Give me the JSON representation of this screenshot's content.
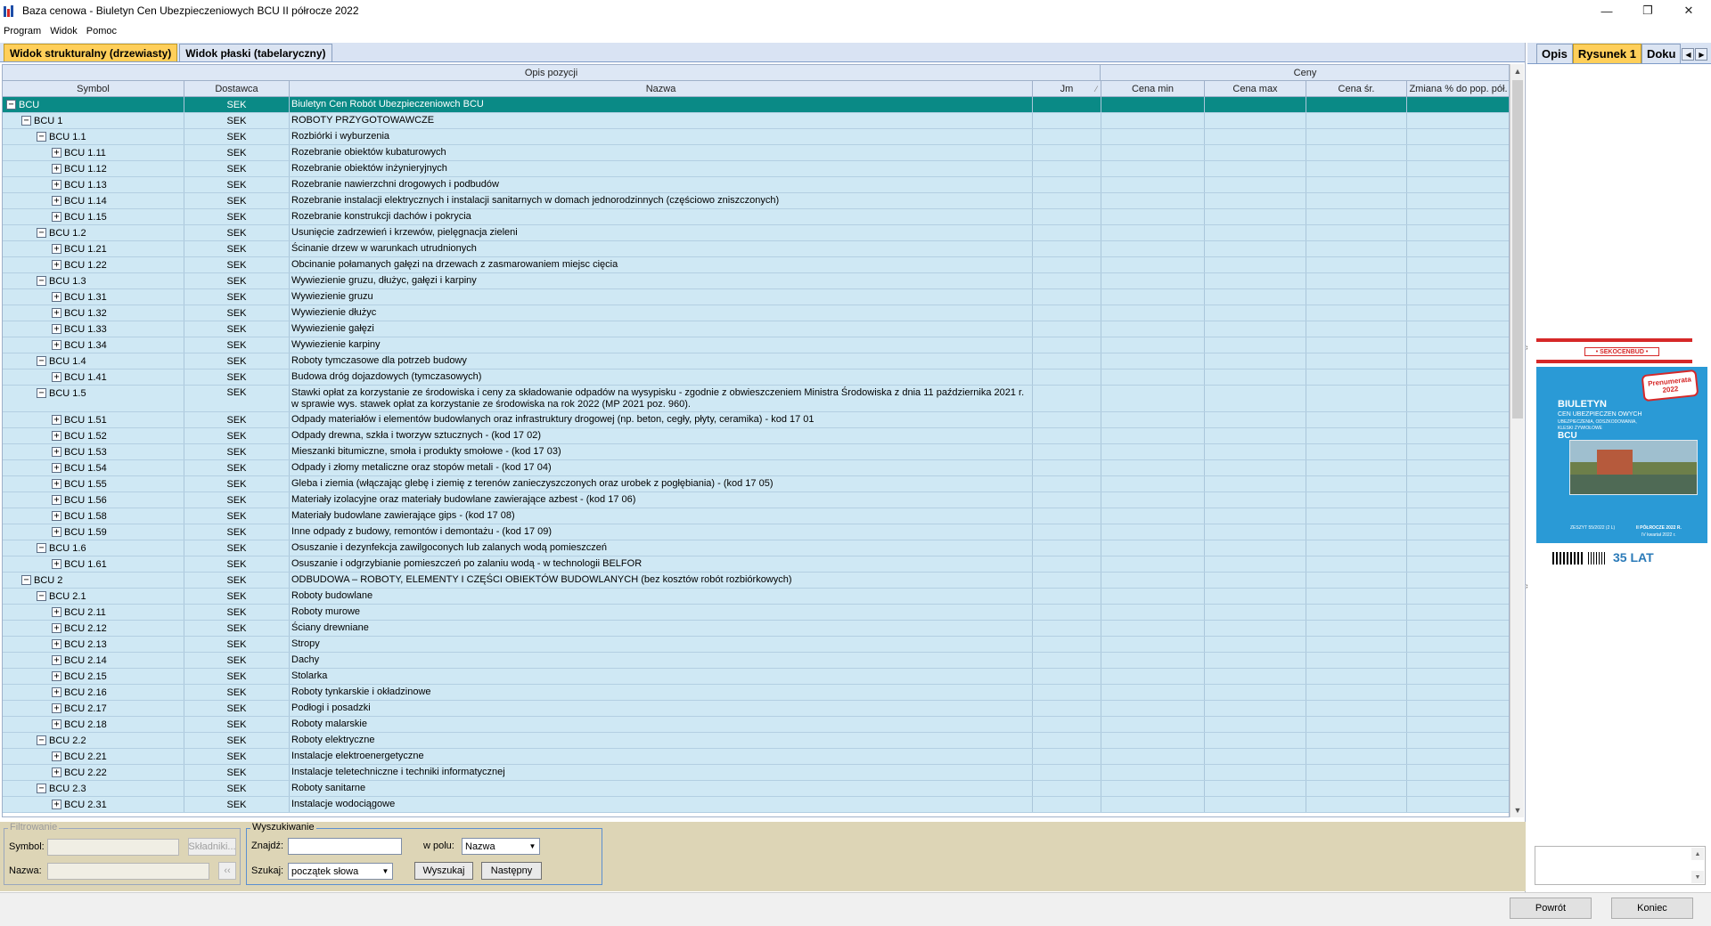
{
  "window": {
    "title": "Baza cenowa - Biuletyn Cen Ubezpieczeniowych BCU II półrocze 2022"
  },
  "menu": [
    "Program",
    "Widok",
    "Pomoc"
  ],
  "tabs": [
    "Widok strukturalny (drzewiasty)",
    "Widok płaski (tabelaryczny)"
  ],
  "header_groups": {
    "opis": "Opis pozycji",
    "ceny": "Ceny"
  },
  "columns": {
    "symbol": "Symbol",
    "dostawca": "Dostawca",
    "nazwa": "Nazwa",
    "jm": "Jm",
    "cena_min": "Cena min",
    "cena_max": "Cena max",
    "cena_sr": "Cena śr.",
    "zmiana": "Zmiana % do pop. pół."
  },
  "rows": [
    {
      "level": 0,
      "sign": "−",
      "symbol": "BCU",
      "dostawca": "SEK",
      "nazwa": "Biuletyn Cen Robót Ubezpieczeniowch BCU",
      "selected": true
    },
    {
      "level": 1,
      "sign": "−",
      "symbol": "BCU 1",
      "dostawca": "SEK",
      "nazwa": "ROBOTY PRZYGOTOWAWCZE"
    },
    {
      "level": 2,
      "sign": "−",
      "symbol": "BCU 1.1",
      "dostawca": "SEK",
      "nazwa": "Rozbiórki i wyburzenia"
    },
    {
      "level": 3,
      "sign": "+",
      "symbol": "BCU 1.11",
      "dostawca": "SEK",
      "nazwa": "Rozebranie obiektów kubaturowych"
    },
    {
      "level": 3,
      "sign": "+",
      "symbol": "BCU 1.12",
      "dostawca": "SEK",
      "nazwa": "Rozebranie obiektów inżynieryjnych"
    },
    {
      "level": 3,
      "sign": "+",
      "symbol": "BCU 1.13",
      "dostawca": "SEK",
      "nazwa": "Rozebranie nawierzchni drogowych i podbudów"
    },
    {
      "level": 3,
      "sign": "+",
      "symbol": "BCU 1.14",
      "dostawca": "SEK",
      "nazwa": "Rozebranie instalacji elektrycznych i instalacji sanitarnych w domach jednorodzinnych (częściowo zniszczonych)"
    },
    {
      "level": 3,
      "sign": "+",
      "symbol": "BCU 1.15",
      "dostawca": "SEK",
      "nazwa": "Rozebranie konstrukcji dachów i pokrycia"
    },
    {
      "level": 2,
      "sign": "−",
      "symbol": "BCU 1.2",
      "dostawca": "SEK",
      "nazwa": "Usunięcie zadrzewień i krzewów, pielęgnacja zieleni"
    },
    {
      "level": 3,
      "sign": "+",
      "symbol": "BCU 1.21",
      "dostawca": "SEK",
      "nazwa": "Ścinanie drzew w warunkach utrudnionych"
    },
    {
      "level": 3,
      "sign": "+",
      "symbol": "BCU 1.22",
      "dostawca": "SEK",
      "nazwa": "Obcinanie połamanych gałęzi na drzewach z zasmarowaniem miejsc cięcia"
    },
    {
      "level": 2,
      "sign": "−",
      "symbol": "BCU 1.3",
      "dostawca": "SEK",
      "nazwa": "Wywiezienie gruzu, dłużyc, gałęzi i karpiny"
    },
    {
      "level": 3,
      "sign": "+",
      "symbol": "BCU 1.31",
      "dostawca": "SEK",
      "nazwa": "Wywiezienie gruzu"
    },
    {
      "level": 3,
      "sign": "+",
      "symbol": "BCU 1.32",
      "dostawca": "SEK",
      "nazwa": "Wywiezienie dłużyc"
    },
    {
      "level": 3,
      "sign": "+",
      "symbol": "BCU 1.33",
      "dostawca": "SEK",
      "nazwa": "Wywiezienie gałęzi"
    },
    {
      "level": 3,
      "sign": "+",
      "symbol": "BCU 1.34",
      "dostawca": "SEK",
      "nazwa": "Wywiezienie karpiny"
    },
    {
      "level": 2,
      "sign": "−",
      "symbol": "BCU 1.4",
      "dostawca": "SEK",
      "nazwa": "Roboty tymczasowe dla potrzeb budowy"
    },
    {
      "level": 3,
      "sign": "+",
      "symbol": "BCU 1.41",
      "dostawca": "SEK",
      "nazwa": "Budowa dróg dojazdowych (tymczasowych)"
    },
    {
      "level": 2,
      "sign": "−",
      "symbol": "BCU 1.5",
      "dostawca": "SEK",
      "nazwa": "Stawki opłat za korzystanie ze środowiska i ceny za składowanie odpadów na wysypisku - zgodnie z obwieszczeniem Ministra Środowiska z dnia 11 października 2021 r. w sprawie wys. stawek opłat za korzystanie ze środowiska na rok 2022 (MP 2021 poz. 960).",
      "tall": true
    },
    {
      "level": 3,
      "sign": "+",
      "symbol": "BCU 1.51",
      "dostawca": "SEK",
      "nazwa": "Odpady materiałów i elementów budowlanych oraz infrastruktury drogowej (np. beton, cegły, płyty, ceramika) - kod 17 01"
    },
    {
      "level": 3,
      "sign": "+",
      "symbol": "BCU 1.52",
      "dostawca": "SEK",
      "nazwa": "Odpady drewna, szkła i tworzyw sztucznych - (kod 17 02)"
    },
    {
      "level": 3,
      "sign": "+",
      "symbol": "BCU 1.53",
      "dostawca": "SEK",
      "nazwa": "Mieszanki bitumiczne, smoła i produkty smołowe - (kod 17 03)"
    },
    {
      "level": 3,
      "sign": "+",
      "symbol": "BCU 1.54",
      "dostawca": "SEK",
      "nazwa": "Odpady i złomy metaliczne oraz stopów metali - (kod 17 04)"
    },
    {
      "level": 3,
      "sign": "+",
      "symbol": "BCU 1.55",
      "dostawca": "SEK",
      "nazwa": "Gleba i ziemia (włączając glebę i ziemię z terenów zanieczyszczonych oraz urobek z pogłębiania) - (kod 17 05)"
    },
    {
      "level": 3,
      "sign": "+",
      "symbol": "BCU 1.56",
      "dostawca": "SEK",
      "nazwa": "Materiały izolacyjne oraz materiały budowlane zawierające azbest - (kod 17 06)"
    },
    {
      "level": 3,
      "sign": "+",
      "symbol": "BCU 1.58",
      "dostawca": "SEK",
      "nazwa": "Materiały budowlane zawierające gips - (kod 17 08)"
    },
    {
      "level": 3,
      "sign": "+",
      "symbol": "BCU 1.59",
      "dostawca": "SEK",
      "nazwa": "Inne odpady z budowy, remontów i demontażu - (kod 17 09)"
    },
    {
      "level": 2,
      "sign": "−",
      "symbol": "BCU 1.6",
      "dostawca": "SEK",
      "nazwa": "Osuszanie i dezynfekcja zawilgoconych lub zalanych wodą pomieszczeń"
    },
    {
      "level": 3,
      "sign": "+",
      "symbol": "BCU 1.61",
      "dostawca": "SEK",
      "nazwa": "Osuszanie i odgrzybianie pomieszczeń po zalaniu wodą - w technologii BELFOR"
    },
    {
      "level": 1,
      "sign": "−",
      "symbol": "BCU 2",
      "dostawca": "SEK",
      "nazwa": "ODBUDOWA – ROBOTY, ELEMENTY I CZĘŚCI OBIEKTÓW BUDOWLANYCH (bez kosztów robót rozbiórkowych)"
    },
    {
      "level": 2,
      "sign": "−",
      "symbol": "BCU 2.1",
      "dostawca": "SEK",
      "nazwa": "Roboty budowlane"
    },
    {
      "level": 3,
      "sign": "+",
      "symbol": "BCU 2.11",
      "dostawca": "SEK",
      "nazwa": "Roboty murowe"
    },
    {
      "level": 3,
      "sign": "+",
      "symbol": "BCU 2.12",
      "dostawca": "SEK",
      "nazwa": "Ściany drewniane"
    },
    {
      "level": 3,
      "sign": "+",
      "symbol": "BCU 2.13",
      "dostawca": "SEK",
      "nazwa": "Stropy"
    },
    {
      "level": 3,
      "sign": "+",
      "symbol": "BCU 2.14",
      "dostawca": "SEK",
      "nazwa": "Dachy"
    },
    {
      "level": 3,
      "sign": "+",
      "symbol": "BCU 2.15",
      "dostawca": "SEK",
      "nazwa": "Stolarka"
    },
    {
      "level": 3,
      "sign": "+",
      "symbol": "BCU 2.16",
      "dostawca": "SEK",
      "nazwa": "Roboty tynkarskie i okładzinowe"
    },
    {
      "level": 3,
      "sign": "+",
      "symbol": "BCU 2.17",
      "dostawca": "SEK",
      "nazwa": "Podłogi i posadzki"
    },
    {
      "level": 3,
      "sign": "+",
      "symbol": "BCU 2.18",
      "dostawca": "SEK",
      "nazwa": "Roboty malarskie"
    },
    {
      "level": 2,
      "sign": "−",
      "symbol": "BCU 2.2",
      "dostawca": "SEK",
      "nazwa": "Roboty elektryczne"
    },
    {
      "level": 3,
      "sign": "+",
      "symbol": "BCU 2.21",
      "dostawca": "SEK",
      "nazwa": "Instalacje elektroenergetyczne"
    },
    {
      "level": 3,
      "sign": "+",
      "symbol": "BCU 2.22",
      "dostawca": "SEK",
      "nazwa": "Instalacje teletechniczne i techniki informatycznej"
    },
    {
      "level": 2,
      "sign": "−",
      "symbol": "BCU 2.3",
      "dostawca": "SEK",
      "nazwa": "Roboty sanitarne"
    },
    {
      "level": 3,
      "sign": "+",
      "symbol": "BCU 2.31",
      "dostawca": "SEK",
      "nazwa": "Instalacje wodociągowe"
    }
  ],
  "filter": {
    "legend": "Filtrowanie",
    "symbol_label": "Symbol:",
    "nazwa_label": "Nazwa:",
    "skladniki_label": "Składniki...",
    "clear_label": "‹‹"
  },
  "search": {
    "legend": "Wyszukiwanie",
    "znajdz_label": "Znajdź:",
    "w_polu_label": "w polu:",
    "w_polu_value": "Nazwa",
    "szukaj_label": "Szukaj:",
    "szukaj_value": "początek słowa",
    "wyszukaj_label": "Wyszukaj",
    "nastepny_label": "Następny"
  },
  "right_tabs": [
    "Opis",
    "Rysunek 1",
    "Doku"
  ],
  "cover": {
    "brand": "• SEKOCENBUD •",
    "title": "BIULETYN",
    "subtitle_1": "CEN UBEZPIECZEN OWYCH",
    "subtitle_2": "UBEZPIECZENIA, ODSZKODOWANIA,",
    "subtitle_3": "KLESKI ŻYWIOŁOWE",
    "code": "BCU",
    "sticker": "Prenumerata 2022",
    "bottom_1": "ZESZYT 55/2022 (2 L)",
    "bottom_2": "II PÓŁROCZE 2022 R.",
    "bottom_3": "IV kwartał 2022 r.",
    "bottom_4": "35 LAT"
  },
  "footer": {
    "powrot": "Powrót",
    "koniec": "Koniec"
  },
  "colors": {
    "row_bg": "#cfe8f4",
    "selected_bg": "#0a8a86",
    "active_tab": "#ffcf5a",
    "bottom_panel": "#ddd5b6"
  }
}
